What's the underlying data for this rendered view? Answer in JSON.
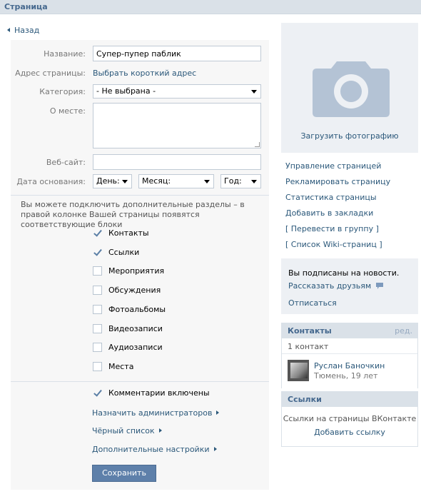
{
  "topbar": {
    "title": "Страница"
  },
  "back": {
    "label": "Назад"
  },
  "form": {
    "name_label": "Название:",
    "name_value": "Супер-пупер паблик",
    "address_label": "Адрес страницы:",
    "address_link": "Выбрать короткий адрес",
    "category_label": "Категория:",
    "category_value": "- Не выбрана -",
    "about_label": "О месте:",
    "about_value": "",
    "website_label": "Веб-сайт:",
    "website_value": "",
    "founded_label": "Дата основания:",
    "day_value": "День:",
    "month_value": "Месяц:",
    "year_value": "Год:",
    "info_text": "Вы можете подключить дополнительные разделы – в правой колонке Вашей страницы появятся соответствующие блоки",
    "sections": [
      {
        "label": "Контакты",
        "checked": true
      },
      {
        "label": "Ссылки",
        "checked": true
      },
      {
        "label": "Мероприятия",
        "checked": false
      },
      {
        "label": "Обсуждения",
        "checked": false
      },
      {
        "label": "Фотоальбомы",
        "checked": false
      },
      {
        "label": "Видеозаписи",
        "checked": false
      },
      {
        "label": "Аудиозаписи",
        "checked": false
      },
      {
        "label": "Места",
        "checked": false
      }
    ],
    "comments": {
      "label": "Комментарии включены",
      "checked": true
    },
    "assign_admins": "Назначить администраторов",
    "blacklist": "Чёрный список",
    "advanced": "Дополнительные настройки",
    "save": "Сохранить"
  },
  "sidebar": {
    "upload_photo": "Загрузить фотографию",
    "menu": [
      "Управление страницей",
      "Рекламировать страницу",
      "Статистика страницы",
      "Добавить в закладки",
      "[ Перевести в группу ]",
      "[ Список Wiki-страниц ]"
    ],
    "subscribed": "Вы подписаны на новости.",
    "tell_friends": "Рассказать друзьям",
    "unsubscribe": "Отписаться",
    "contacts": {
      "title": "Контакты",
      "edit": "ред.",
      "count": "1 контакт",
      "person_name": "Руслан Баночкин",
      "person_info": "Тюмень, 19 лет"
    },
    "links": {
      "title": "Ссылки",
      "text": "Ссылки на страницы ВКонтакте",
      "add": "Добавить ссылку"
    }
  },
  "colors": {
    "link": "#2b587a",
    "header_bg": "#dae1e8",
    "button": "#5e80aa"
  }
}
